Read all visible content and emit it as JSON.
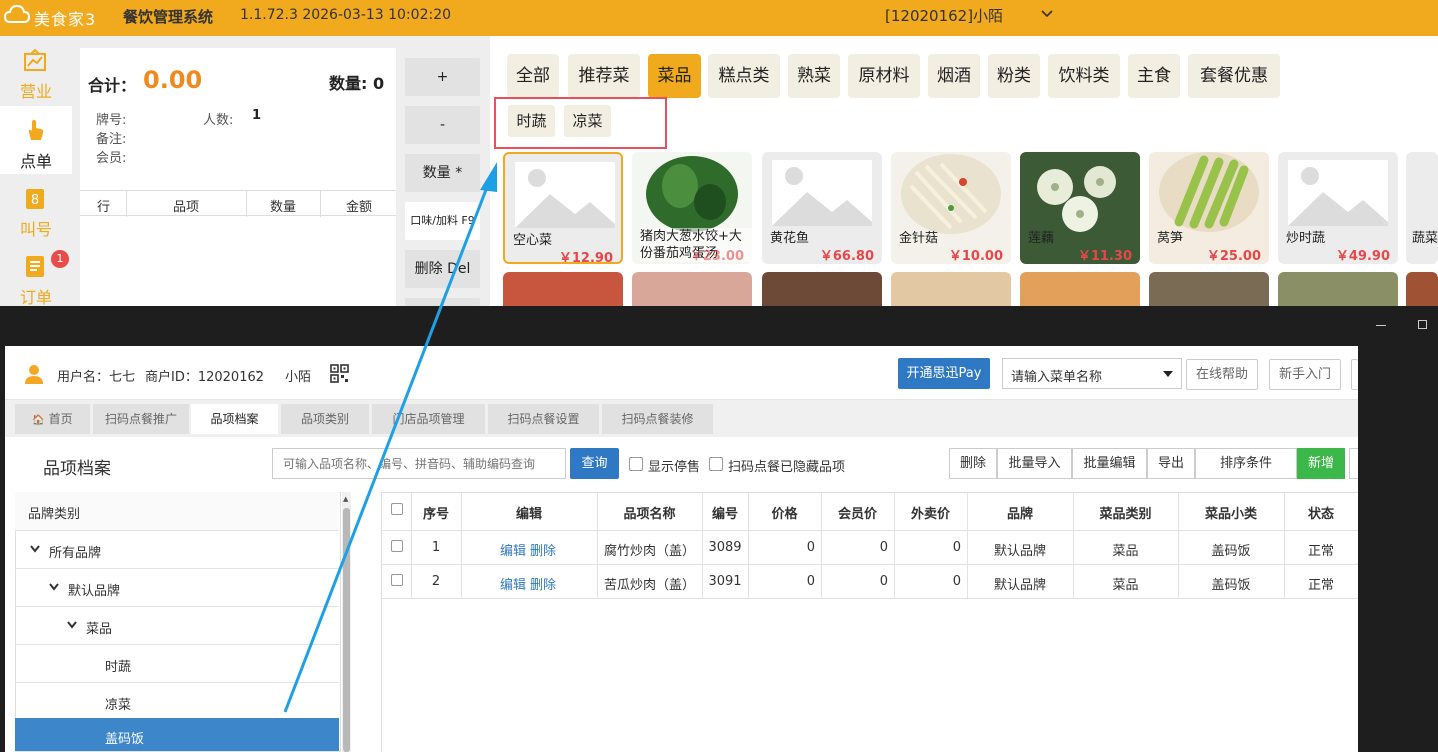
{
  "topbar": {
    "logo_text": "美食家3",
    "system_name": "餐饮管理系统",
    "version_time": "1.1.72.3 2026-03-13 10:02:20",
    "store_user": "[12020162]小陌"
  },
  "leftnav": {
    "items": [
      {
        "label": "营业",
        "icon": "chart-icon"
      },
      {
        "label": "点单",
        "icon": "tap-hand-icon"
      },
      {
        "label": "叫号",
        "icon": "number-ticket-icon"
      },
      {
        "label": "订单",
        "icon": "order-list-icon",
        "badge": "1"
      }
    ]
  },
  "order": {
    "total_label": "合计：",
    "total_value": "0.00",
    "qty_label": "数量:",
    "qty_value": "0",
    "table_label": "牌号:",
    "people_label": "人数:",
    "people_value": "1",
    "note_label": "备注:",
    "member_label": "会员:",
    "columns": [
      "行",
      "品项",
      "数量",
      "金额"
    ]
  },
  "op_buttons": [
    "+",
    "-",
    "数量 *",
    "口味/加料 F9",
    "删除 Del"
  ],
  "categories": {
    "tabs": [
      "全部",
      "推荐菜",
      "菜品",
      "糕点类",
      "熟菜",
      "原材料",
      "烟酒",
      "粉类",
      "饮料类",
      "主食",
      "套餐优惠"
    ],
    "active": "菜品",
    "subtabs": [
      "时蔬",
      "凉菜"
    ]
  },
  "dishes": [
    {
      "name": "空心菜",
      "price": "￥12.90"
    },
    {
      "name": "猪肉大葱水饺+大份番茄鸡蛋汤",
      "price": "￥23.00"
    },
    {
      "name": "黄花鱼",
      "price": "￥66.80"
    },
    {
      "name": "金针菇",
      "price": "￥10.00"
    },
    {
      "name": "莲藕",
      "price": "￥11.30"
    },
    {
      "name": "莴笋",
      "price": "￥25.00"
    },
    {
      "name": "炒时蔬",
      "price": "￥49.90"
    },
    {
      "name": "蔬菜",
      "price": ""
    }
  ],
  "backoffice": {
    "user_label": "用户名：七七",
    "merchant_label": "商户ID：12020162",
    "store_name": "小陌",
    "pay_button": "开通思迅Pay",
    "menu_search_placeholder": "请输入菜单名称",
    "help_button": "在线帮助",
    "guide_button": "新手入门",
    "tabs": [
      "首页",
      "扫码点餐推广",
      "品项档案",
      "品项类别",
      "门店品项管理",
      "扫码点餐设置",
      "扫码点餐装修"
    ],
    "active_tab": "品项档案",
    "page_title": "品项档案",
    "search_placeholder": "可输入品项名称、编号、拼音码、辅助编码查询",
    "query_button": "查询",
    "check_show_stopped": "显示停售",
    "check_hidden_scan": "扫码点餐已隐藏品项",
    "actions": [
      "删除",
      "批量导入",
      "批量编辑",
      "导出",
      "排序条件",
      "新增"
    ],
    "tree_header": "品牌类别",
    "tree": [
      "所有品牌",
      "默认品牌",
      "菜品",
      "时蔬",
      "凉菜",
      "盖码饭"
    ],
    "tree_selected": "盖码饭",
    "table": {
      "columns": [
        "序号",
        "编辑",
        "品项名称",
        "编号",
        "价格",
        "会员价",
        "外卖价",
        "品牌",
        "菜品类别",
        "菜品小类",
        "状态"
      ],
      "rows": [
        {
          "no": "1",
          "edit": "编辑",
          "del": "删除",
          "name": "腐竹炒肉（盖）",
          "code": "3089",
          "price": "0",
          "member": "0",
          "takeout": "0",
          "brand": "默认品牌",
          "cat": "菜品",
          "sub": "盖码饭",
          "status": "正常"
        },
        {
          "no": "2",
          "edit": "编辑",
          "del": "删除",
          "name": "苦瓜炒肉（盖）",
          "code": "3091",
          "price": "0",
          "member": "0",
          "takeout": "0",
          "brand": "默认品牌",
          "cat": "菜品",
          "sub": "盖码饭",
          "status": "正常"
        }
      ]
    }
  },
  "colors": {
    "brand_orange": "#f1a91d",
    "price_red": "#e8474a",
    "link_blue": "#2f78c4",
    "annotation_red": "#e8505b",
    "arrow_blue": "#1ea0e6",
    "new_green": "#3cb84b"
  }
}
